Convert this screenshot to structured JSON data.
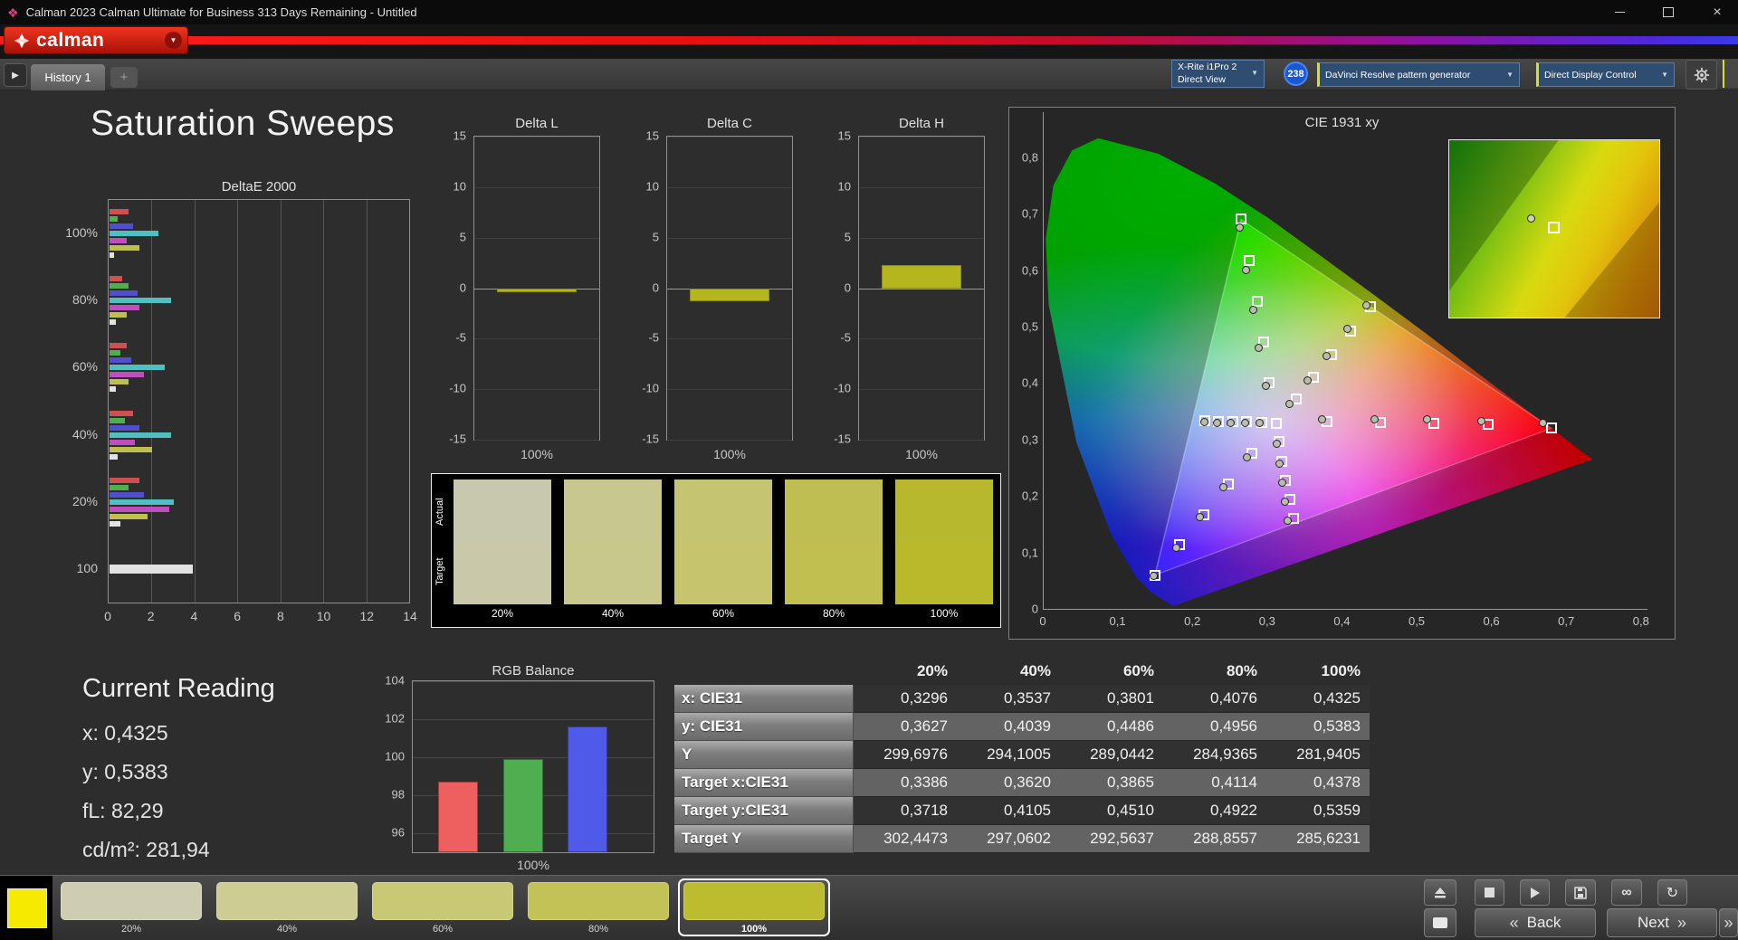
{
  "window": {
    "title": "Calman 2023 Calman Ultimate for Business 313 Days Remaining  - Untitled"
  },
  "brand": {
    "name": "calman"
  },
  "icons": {
    "dropdown_arrow": "▼",
    "plus": "+",
    "play": "▶",
    "infinity": "∞",
    "refresh": "↻",
    "back_chevron": "«",
    "next_chevron": "»",
    "close": "×"
  },
  "tabs": {
    "history": "History 1"
  },
  "devices": {
    "meter_line1": "X-Rite i1Pro 2",
    "meter_line2": "Direct View",
    "meter_badge": "238",
    "generator": "DaVinci Resolve pattern generator",
    "display_control": "Direct Display Control"
  },
  "page": {
    "title": "Saturation Sweeps"
  },
  "deltae": {
    "title": "DeltaE 2000",
    "xmax": 14,
    "xticks": [
      0,
      2,
      4,
      6,
      8,
      10,
      12,
      14
    ],
    "group_labels": [
      "100%",
      "80%",
      "60%",
      "40%",
      "20%",
      "100"
    ],
    "groups": [
      [
        0.9,
        0.4,
        1.1,
        2.3,
        0.8,
        1.4,
        0.2
      ],
      [
        0.6,
        0.9,
        1.3,
        2.9,
        1.4,
        0.8,
        0.3
      ],
      [
        0.8,
        0.5,
        1.0,
        2.6,
        1.6,
        0.9,
        0.3
      ],
      [
        1.1,
        0.7,
        1.4,
        2.9,
        1.2,
        2.0,
        0.4
      ],
      [
        1.4,
        0.9,
        1.6,
        3.0,
        2.8,
        1.8,
        0.5
      ],
      [
        3.9
      ]
    ],
    "colors": [
      "#cf5050",
      "#4faf4f",
      "#5050cf",
      "#4fbfbf",
      "#bf4fbf",
      "#bfbf4f",
      "#e2e2e2"
    ]
  },
  "delta_charts": {
    "ticks": [
      15,
      10,
      5,
      0,
      -5,
      -10,
      -15
    ],
    "range": 15,
    "xlabel": "100%",
    "bar_color": "#b5b51e",
    "charts": [
      {
        "title": "Delta L",
        "value": -0.4
      },
      {
        "title": "Delta C",
        "value": -1.3
      },
      {
        "title": "Delta H",
        "value": 2.3
      }
    ]
  },
  "swatch_panel": {
    "row_labels": [
      "Actual",
      "Target"
    ],
    "columns": [
      {
        "label": "20%",
        "actual": "#c7c8ad",
        "target": "#c9c9a9"
      },
      {
        "label": "40%",
        "actual": "#c7c78f",
        "target": "#c9c88c"
      },
      {
        "label": "60%",
        "actual": "#c4c471",
        "target": "#c6c56e"
      },
      {
        "label": "80%",
        "actual": "#bebe52",
        "target": "#c0bf50"
      },
      {
        "label": "100%",
        "actual": "#b8b82e",
        "target": "#bab92c"
      }
    ]
  },
  "cie": {
    "title": "CIE 1931 xy",
    "xticks": [
      "0",
      "0,1",
      "0,2",
      "0,3",
      "0,4",
      "0,5",
      "0,6",
      "0,7",
      "0,8"
    ],
    "yticks": [
      "0",
      "0,1",
      "0,2",
      "0,3",
      "0,4",
      "0,5",
      "0,6",
      "0,7",
      "0,8"
    ],
    "targets": [
      [
        0.3386,
        0.3718
      ],
      [
        0.362,
        0.4105
      ],
      [
        0.3865,
        0.451
      ],
      [
        0.4114,
        0.4922
      ],
      [
        0.4378,
        0.5359
      ],
      [
        0.38,
        0.331
      ],
      [
        0.452,
        0.33
      ],
      [
        0.523,
        0.329
      ],
      [
        0.596,
        0.327
      ],
      [
        0.68,
        0.32
      ],
      [
        0.303,
        0.401
      ],
      [
        0.295,
        0.473
      ],
      [
        0.287,
        0.545
      ],
      [
        0.276,
        0.617
      ],
      [
        0.265,
        0.69
      ],
      [
        0.28,
        0.275
      ],
      [
        0.248,
        0.221
      ],
      [
        0.215,
        0.167
      ],
      [
        0.183,
        0.113
      ],
      [
        0.15,
        0.06
      ],
      [
        0.293,
        0.33
      ],
      [
        0.273,
        0.331
      ],
      [
        0.254,
        0.331
      ],
      [
        0.235,
        0.332
      ],
      [
        0.217,
        0.333
      ],
      [
        0.316,
        0.296
      ],
      [
        0.32,
        0.262
      ],
      [
        0.325,
        0.228
      ],
      [
        0.33,
        0.194
      ],
      [
        0.335,
        0.16
      ],
      [
        0.3127,
        0.329
      ]
    ],
    "measured": [
      [
        0.3296,
        0.3627
      ],
      [
        0.3537,
        0.4039
      ],
      [
        0.3801,
        0.4486
      ],
      [
        0.4076,
        0.4956
      ],
      [
        0.4325,
        0.5383
      ],
      [
        0.373,
        0.336
      ],
      [
        0.444,
        0.336
      ],
      [
        0.514,
        0.335
      ],
      [
        0.586,
        0.333
      ],
      [
        0.669,
        0.329
      ],
      [
        0.298,
        0.395
      ],
      [
        0.289,
        0.462
      ],
      [
        0.282,
        0.53
      ],
      [
        0.272,
        0.6
      ],
      [
        0.263,
        0.675
      ],
      [
        0.273,
        0.269
      ],
      [
        0.242,
        0.216
      ],
      [
        0.21,
        0.162
      ],
      [
        0.179,
        0.108
      ],
      [
        0.148,
        0.059
      ],
      [
        0.29,
        0.329
      ],
      [
        0.27,
        0.329
      ],
      [
        0.251,
        0.33
      ],
      [
        0.233,
        0.33
      ],
      [
        0.216,
        0.331
      ],
      [
        0.313,
        0.292
      ],
      [
        0.316,
        0.258
      ],
      [
        0.32,
        0.224
      ],
      [
        0.324,
        0.19
      ],
      [
        0.328,
        0.157
      ]
    ]
  },
  "current_reading": {
    "title": "Current Reading",
    "lines": [
      "x: 0,4325",
      "y: 0,5383",
      "fL: 82,29",
      "cd/m²: 281,94"
    ]
  },
  "rgb": {
    "title": "RGB Balance",
    "ticks": [
      104,
      102,
      100,
      98,
      96
    ],
    "min": 95,
    "max": 104,
    "xlabel": "100%",
    "bars": [
      {
        "name": "red",
        "color": "#ee5f5f",
        "value": 98.7
      },
      {
        "name": "green",
        "color": "#4fae4f",
        "value": 99.9
      },
      {
        "name": "blue",
        "color": "#505ae8",
        "value": 101.6
      }
    ]
  },
  "table": {
    "columns": [
      "20%",
      "40%",
      "60%",
      "80%",
      "100%"
    ],
    "rows": [
      {
        "label": "x: CIE31",
        "values": [
          "0,3296",
          "0,3537",
          "0,3801",
          "0,4076",
          "0,4325"
        ]
      },
      {
        "label": "y: CIE31",
        "values": [
          "0,3627",
          "0,4039",
          "0,4486",
          "0,4956",
          "0,5383"
        ]
      },
      {
        "label": "Y",
        "values": [
          "299,6976",
          "294,1005",
          "289,0442",
          "284,9365",
          "281,9405"
        ]
      },
      {
        "label": "Target x:CIE31",
        "values": [
          "0,3386",
          "0,3620",
          "0,3865",
          "0,4114",
          "0,4378"
        ]
      },
      {
        "label": "Target y:CIE31",
        "values": [
          "0,3718",
          "0,4105",
          "0,4510",
          "0,4922",
          "0,5359"
        ]
      },
      {
        "label": "Target Y",
        "values": [
          "302,4473",
          "297,0602",
          "292,5637",
          "288,8557",
          "285,6231"
        ]
      }
    ]
  },
  "bottom": {
    "patterns": [
      {
        "label": "20%",
        "color": "#cecdb2",
        "selected": false
      },
      {
        "label": "40%",
        "color": "#cccc93",
        "selected": false
      },
      {
        "label": "60%",
        "color": "#c8c875",
        "selected": false
      },
      {
        "label": "80%",
        "color": "#c2c256",
        "selected": false
      },
      {
        "label": "100%",
        "color": "#bcbc2e",
        "selected": true
      }
    ],
    "back": "Back",
    "next": "Next"
  }
}
